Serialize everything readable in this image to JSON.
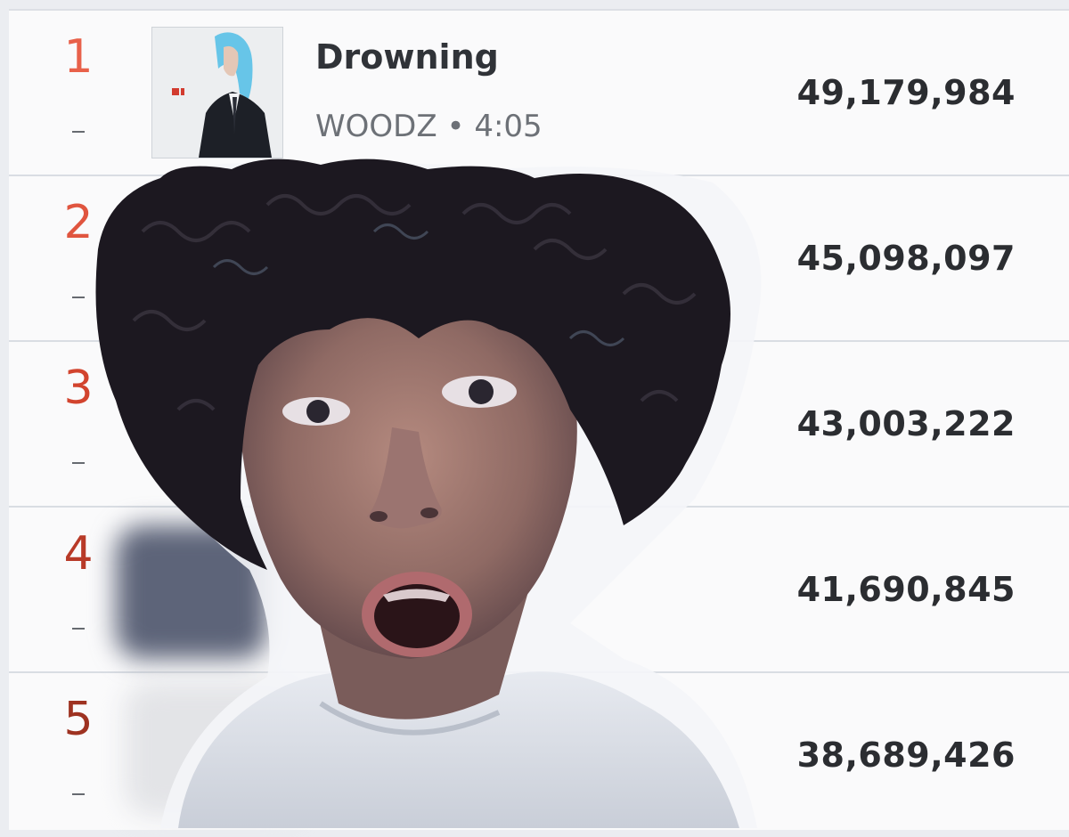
{
  "colors": {
    "rank": [
      "#e8614a",
      "#e0553f",
      "#d2442e",
      "#b83a28",
      "#9e3221"
    ],
    "title": "#303338",
    "subtitle": "#6d7177",
    "streams": "#2b2d31"
  },
  "chart": {
    "rows": [
      {
        "rank": "1",
        "title": "Drowning",
        "artist": "WOODZ",
        "separator": "•",
        "duration": "4:05",
        "streams": "49,179,984",
        "change": "no-change-icon"
      },
      {
        "rank": "2",
        "streams": "45,098,097",
        "change": "no-change-icon"
      },
      {
        "rank": "3",
        "streams": "43,003,222",
        "change": "no-change-icon"
      },
      {
        "rank": "4",
        "streams": "41,690,845",
        "change": "no-change-icon"
      },
      {
        "rank": "5",
        "streams": "38,689,426",
        "change": "no-change-icon"
      }
    ]
  }
}
